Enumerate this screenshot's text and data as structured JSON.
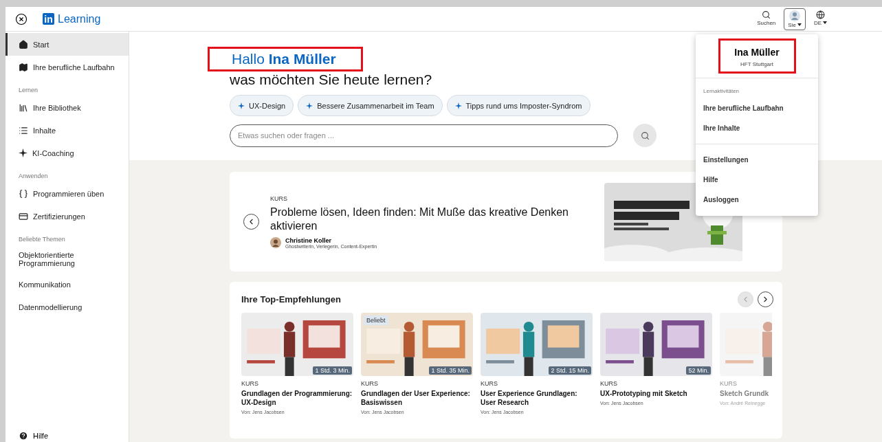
{
  "header": {
    "logo_mark": "in",
    "logo_text": "Learning",
    "actions": [
      {
        "label": "Suchen",
        "kind": "search",
        "selected": false
      },
      {
        "label": "Sie",
        "kind": "profile",
        "selected": true
      },
      {
        "label": "DE",
        "kind": "language",
        "selected": false
      }
    ]
  },
  "sidebar": {
    "sections": [
      {
        "items": [
          {
            "label": "Start",
            "kind": "home",
            "selected": true
          },
          {
            "label": "Ihre berufliche Laufbahn",
            "kind": "map",
            "selected": false
          }
        ]
      },
      {
        "heading": "Lernen",
        "items": [
          {
            "label": "Ihre Bibliothek",
            "kind": "library",
            "selected": false
          },
          {
            "label": "Inhalte",
            "kind": "list",
            "selected": false
          },
          {
            "label": "KI-Coaching",
            "kind": "sparkle",
            "selected": false
          }
        ]
      },
      {
        "heading": "Anwenden",
        "items": [
          {
            "label": "Programmieren üben",
            "kind": "braces",
            "selected": false
          },
          {
            "label": "Zertifizierungen",
            "kind": "certificate",
            "selected": false
          }
        ]
      },
      {
        "heading": "Beliebte Themen",
        "items": [
          {
            "label": "Objektorientierte Programmierung",
            "kind": "topic",
            "selected": false
          },
          {
            "label": "Kommunikation",
            "kind": "topic",
            "selected": false
          },
          {
            "label": "Datenmodellierung",
            "kind": "topic",
            "selected": false
          }
        ]
      }
    ],
    "footer": {
      "label": "Hilfe"
    }
  },
  "hero": {
    "greeting": "Hallo **Ina Müller**",
    "highlighted": true,
    "question": "was möchten Sie heute lernen?",
    "chips": [
      "UX-Design",
      "Bessere Zusammenarbeit im Team",
      "Tipps rund ums Imposter-Syndrom"
    ],
    "search": {
      "placeholder": "Etwas suchen oder fragen ..."
    }
  },
  "featured": {
    "type": "KURS",
    "title": "Probleme lösen, Ideen finden: Mit Muße das kreative Denken aktivieren",
    "author": "Christine Koller",
    "author_role": "Ghostwriterin, Verlegerin, Content-Expertin",
    "kind": "picture"
  },
  "recommendations": {
    "title": "Ihre Top-Empfehlungen",
    "prev_disabled": true,
    "next_disabled": false,
    "courses": [
      {
        "type": "KURS",
        "title": "Grundlagen der Programmierung: UX-Design",
        "author": "Von: Jens Jacobsen",
        "duration": "1 Std. 3 Min."
      },
      {
        "type": "KURS",
        "title": "Grundlagen der User Experience: Basiswissen",
        "author": "Von: Jens Jacobsen",
        "duration": "1 Std. 35 Min.",
        "badge": "Beliebt"
      },
      {
        "type": "KURS",
        "title": "User Experience Grundlagen: User Research",
        "author": "Von: Jens Jacobsen",
        "duration": "2 Std. 15 Min."
      },
      {
        "type": "KURS",
        "title": "UX-Prototyping mit Sketch",
        "author": "Von: Jens Jacobsen",
        "duration": "52 Min."
      },
      {
        "type": "KURS",
        "title": "Sketch Grundk",
        "author": "Von: André Reinegge"
      }
    ]
  },
  "profile_menu": {
    "name": "Ina Müller",
    "org": "HFT Stuttgart",
    "highlighted": true,
    "section_label": "Lernaktivitäten",
    "items": [
      "Ihre berufliche Laufbahn",
      "Ihre Inhalte"
    ],
    "more_items": [
      "Einstellungen",
      "Hilfe",
      "Ausloggen"
    ]
  }
}
